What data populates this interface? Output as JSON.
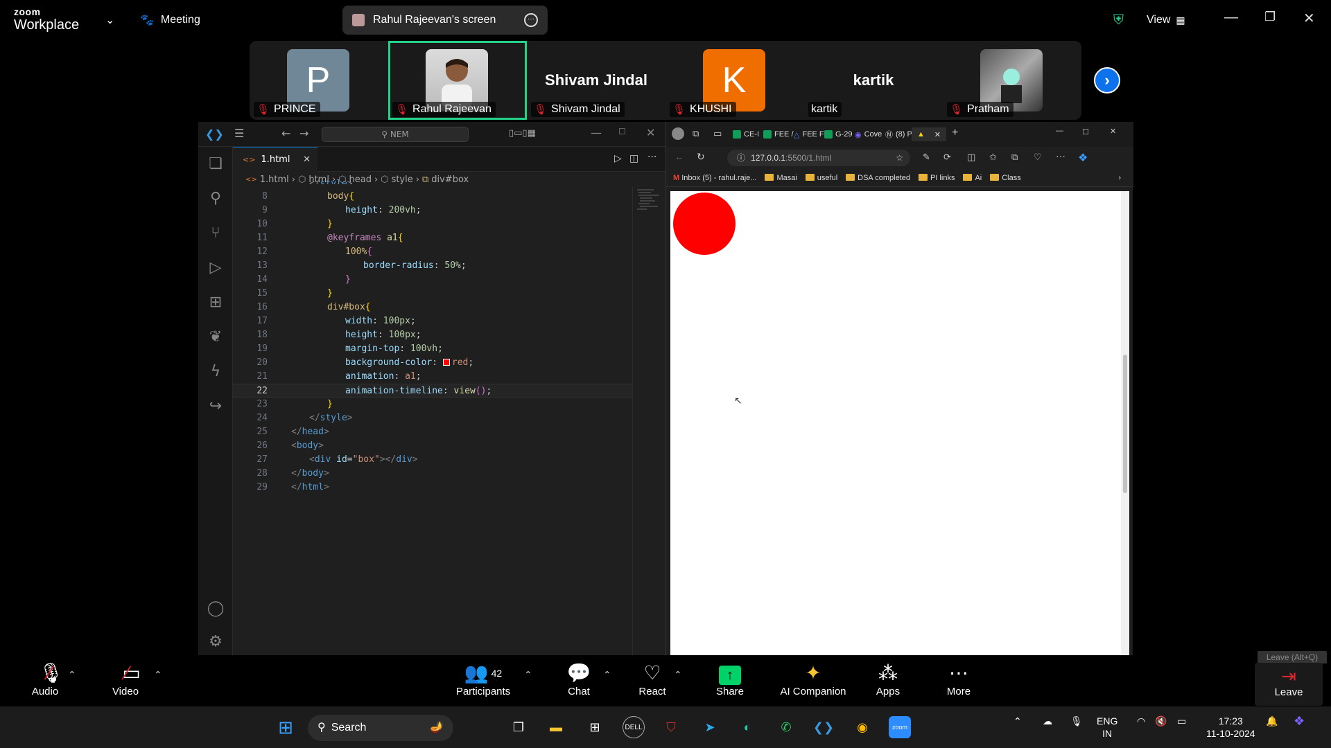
{
  "zoom": {
    "brand_top": "zoom",
    "brand_bottom": "Workplace",
    "meeting_label": "Meeting",
    "share_label": "Rahul Rajeevan's screen",
    "view_label": "View",
    "participants": [
      {
        "name": "PRINCE",
        "initial": "P",
        "color": "#6f8796"
      },
      {
        "name": "Rahul Rajeevan",
        "initial": "",
        "color": "#cfcfcf"
      },
      {
        "name": "Shivam Jindal",
        "display": "Shivam Jindal"
      },
      {
        "name": "KHUSHI",
        "initial": "K",
        "color": "#f06d00"
      },
      {
        "name": "kartik",
        "display": "kartik"
      },
      {
        "name": "Pratham",
        "initial": "",
        "color": "#888"
      }
    ],
    "bottom": {
      "audio": "Audio",
      "video": "Video",
      "participants": "Participants",
      "participants_count": "42",
      "chat": "Chat",
      "react": "React",
      "share": "Share",
      "ai": "AI Companion",
      "apps": "Apps",
      "more": "More",
      "leave": "Leave",
      "leave_tooltip": "Leave (Alt+Q)"
    }
  },
  "vscode": {
    "search": "NEM",
    "tab": "1.html",
    "breadcrumb": [
      "1.html",
      "html",
      "head",
      "style",
      "div#box"
    ],
    "current_line": 22
  },
  "browser": {
    "tabs": [
      "CE-I",
      "FEE /",
      "FEE F",
      "G-29",
      "Cove",
      "(8) P"
    ],
    "url_host": "127.0.0.1",
    "url_path": ":5500/1.html",
    "bookmarks": [
      "Inbox (5) - rahul.raje...",
      "Masai",
      "useful",
      "DSA completed",
      "PI links",
      "Ai",
      "Class"
    ],
    "box_color": "#ff0000"
  },
  "taskbar": {
    "search": "Search",
    "lang_top": "ENG",
    "lang_bottom": "IN",
    "time": "17:23",
    "date": "11-10-2024"
  }
}
